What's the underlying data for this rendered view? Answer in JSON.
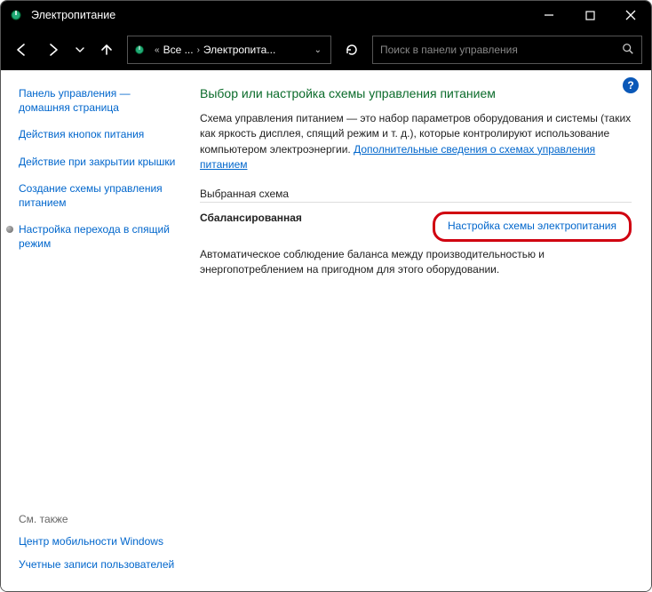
{
  "titlebar": {
    "title": "Электропитание"
  },
  "breadcrumb": {
    "seg1": "Все ...",
    "seg2": "Электропита..."
  },
  "search": {
    "placeholder": "Поиск в панели управления"
  },
  "sidebar": {
    "home": "Панель управления — домашняя страница",
    "items": [
      "Действия кнопок питания",
      "Действие при закрытии крышки",
      "Создание схемы управления питанием",
      "Настройка перехода в спящий режим"
    ],
    "see_also_label": "См. также",
    "see_also": [
      "Центр мобильности Windows",
      "Учетные записи пользователей"
    ]
  },
  "main": {
    "heading": "Выбор или настройка схемы управления питанием",
    "desc_part1": "Схема управления питанием — это набор параметров оборудования и системы (таких как яркость дисплея, спящий режим и т. д.), которые контролируют использование компьютером электроэнергии. ",
    "desc_link": "Дополнительные сведения о схемах управления питанием",
    "section_label": "Выбранная схема",
    "plan_name": "Сбалансированная",
    "plan_link": "Настройка схемы электропитания",
    "plan_desc": "Автоматическое соблюдение баланса между производительностью и энергопотреблением на пригодном для этого оборудовании."
  },
  "help": "?"
}
